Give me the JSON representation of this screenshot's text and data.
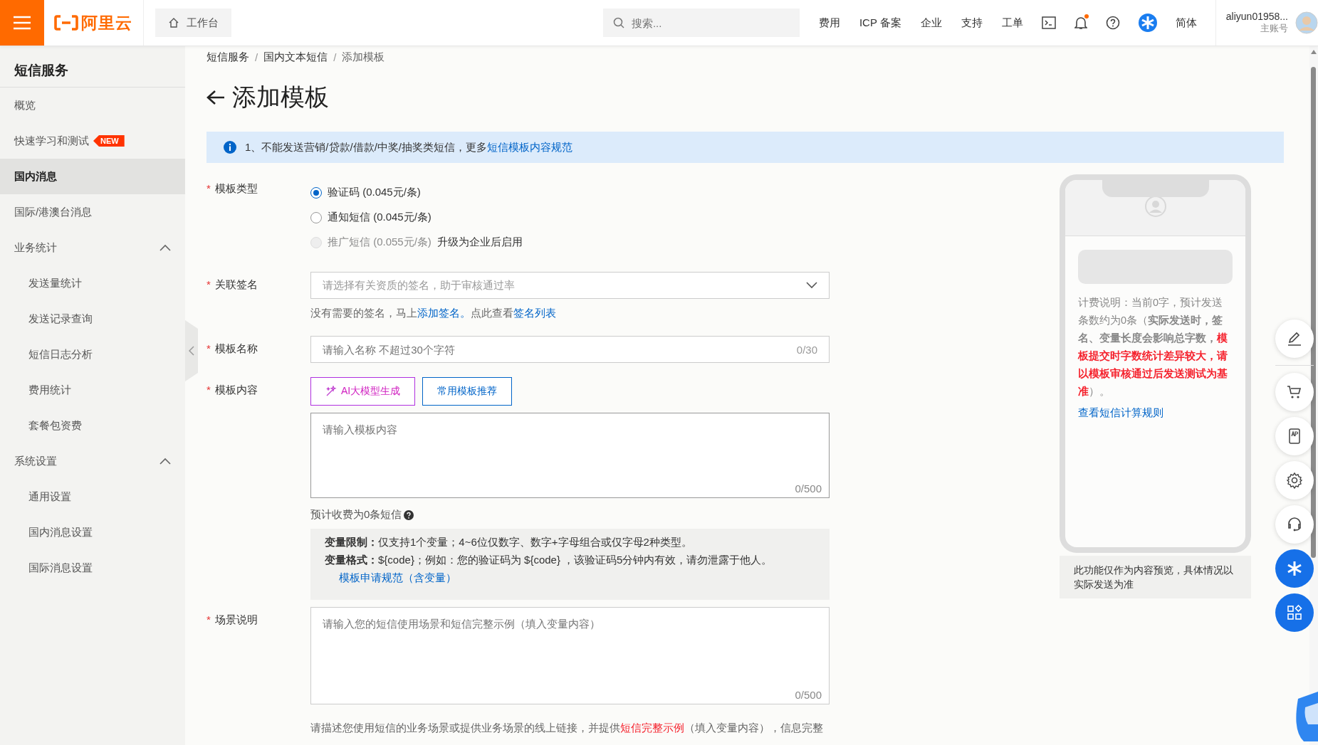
{
  "topbar": {
    "logo": "阿里云",
    "workbench": "工作台",
    "search": {
      "placeholder": "搜索..."
    },
    "links": [
      "费用",
      "ICP 备案",
      "企业",
      "支持",
      "工单"
    ],
    "notification_dot": true,
    "language": "简体",
    "user": {
      "name": "aliyun01958...",
      "role": "主账号"
    }
  },
  "sidebar": {
    "title": "短信服务",
    "items": [
      {
        "label": "概览",
        "selected": false
      },
      {
        "label": "快速学习和测试",
        "badge": "NEW",
        "selected": false
      },
      {
        "label": "国内消息",
        "selected": true
      },
      {
        "label": "国际/港澳台消息",
        "selected": false
      },
      {
        "label": "业务统计",
        "selected": false,
        "expanded": true,
        "children": [
          {
            "label": "发送量统计",
            "selected": false
          },
          {
            "label": "发送记录查询",
            "selected": false
          },
          {
            "label": "短信日志分析",
            "selected": false
          },
          {
            "label": "费用统计",
            "selected": false
          },
          {
            "label": "套餐包资费",
            "selected": false
          }
        ]
      },
      {
        "label": "系统设置",
        "selected": false,
        "expanded": true,
        "children": [
          {
            "label": "通用设置",
            "selected": false
          },
          {
            "label": "国内消息设置",
            "selected": false
          },
          {
            "label": "国际消息设置",
            "selected": false
          }
        ]
      }
    ]
  },
  "breadcrumb": {
    "separator": "/",
    "items": [
      "短信服务",
      "国内文本短信",
      "添加模板"
    ]
  },
  "page_title": "添加模板",
  "notice": {
    "text": "1、不能发送营销/贷款/借款/中奖/抽奖类短信，更多",
    "link": "短信模板内容规范"
  },
  "form": {
    "required_mark": "*",
    "template_type": {
      "label": "模板类型",
      "options": [
        {
          "label": "验证码 (0.045元/条)",
          "selected": true,
          "disabled": false
        },
        {
          "label": "通知短信 (0.045元/条)",
          "selected": false,
          "disabled": false
        },
        {
          "label": "推广短信 (0.055元/条)",
          "selected": false,
          "disabled": true,
          "note": "升级为企业后启用"
        }
      ]
    },
    "signature": {
      "label": "关联签名",
      "placeholder": "请选择有关资质的签名，助于审核通过率",
      "help": [
        {
          "kind": "text",
          "text": "没有需要的签名，马上"
        },
        {
          "kind": "link",
          "text": "添加签名。"
        },
        {
          "kind": "text",
          "text": "点此查看"
        },
        {
          "kind": "link",
          "text": "签名列表"
        }
      ]
    },
    "name": {
      "label": "模板名称",
      "placeholder": "请输入名称 不超过30个字符",
      "counter": "0/30"
    },
    "content": {
      "label": "模板内容",
      "buttons": [
        {
          "kind": "ai",
          "label": "AI大模型生成"
        },
        {
          "kind": "plain",
          "label": "常用模板推荐"
        }
      ],
      "placeholder": "请输入模板内容",
      "counter": "0/500",
      "estimate": "预计收费为0条短信"
    },
    "variable_tips": [
      {
        "title": "变量限制：",
        "text": "仅支持1个变量；4~6位仅数字、数字+字母组合或仅字母2种类型。"
      },
      {
        "title": "变量格式：",
        "text": "${code}；例如：您的验证码为 ${code} ，该验证码5分钟内有效，请勿泄露于他人。"
      }
    ],
    "tips_link": "模板申请规范（含变量）",
    "scenario": {
      "label": "场景说明",
      "placeholder": "请输入您的短信使用场景和短信完整示例（填入变量内容）",
      "counter": "0/500",
      "help": [
        {
          "kind": "text",
          "text": "请描述您使用短信的业务场景或提供业务场景的线上链接，并提供"
        },
        {
          "kind": "red",
          "text": "短信完整示例"
        },
        {
          "kind": "text",
          "text": "（填入变量内容），信息完整"
        }
      ]
    }
  },
  "preview": {
    "billing": [
      {
        "kind": "text",
        "text": "计费说明：当前0字，预计发送条数约为0条（"
      },
      {
        "kind": "bold",
        "text": "实际发送时，签名、变量长度会影响总字数，"
      },
      {
        "kind": "red",
        "text": "模板提交时字数统计差异较大，请以模板审核通过后发送测试为基准"
      },
      {
        "kind": "text",
        "text": "）。"
      }
    ],
    "link": "查看短信计算规则",
    "note": "此功能仅作为内容预览，具体情况以实际发送为准"
  }
}
